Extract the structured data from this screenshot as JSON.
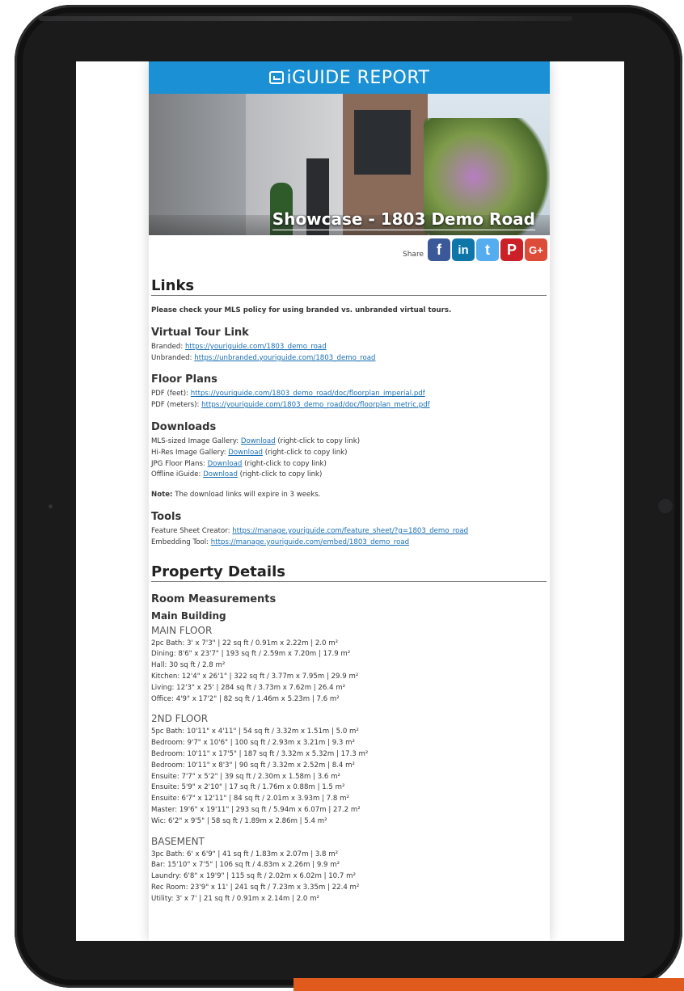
{
  "header": {
    "brand": "iGUIDE REPORT"
  },
  "hero": {
    "caption": "Showcase - 1803 Demo Road"
  },
  "share": {
    "label": "Share",
    "icons": [
      {
        "name": "facebook",
        "glyph": "f",
        "color": "#3b5998"
      },
      {
        "name": "linkedin",
        "glyph": "in",
        "color": "#0e76a8"
      },
      {
        "name": "twitter",
        "glyph": "t",
        "color": "#55acee"
      },
      {
        "name": "pinterest",
        "glyph": "P",
        "color": "#cb2027"
      },
      {
        "name": "google-plus",
        "glyph": "G+",
        "color": "#dd4b39"
      }
    ]
  },
  "links": {
    "title": "Links",
    "intro": "Please check your MLS policy for using branded vs. unbranded virtual tours.",
    "virtual_tour": {
      "title": "Virtual Tour Link",
      "branded_label": "Branded:",
      "branded_url": "https://youriguide.com/1803_demo_road",
      "unbranded_label": "Unbranded:",
      "unbranded_url": "https://unbranded.youriguide.com/1803_demo_road"
    },
    "floor_plans": {
      "title": "Floor Plans",
      "feet_label": "PDF (feet):",
      "feet_url": "https://youriguide.com/1803_demo_road/doc/floorplan_imperial.pdf",
      "meters_label": "PDF (meters):",
      "meters_url": "https://youriguide.com/1803_demo_road/doc/floorplan_metric.pdf"
    },
    "downloads": {
      "title": "Downloads",
      "items": [
        {
          "label": "MLS-sized Image Gallery:",
          "link": "Download",
          "hint": "(right-click to copy link)"
        },
        {
          "label": "Hi-Res Image Gallery:",
          "link": "Download",
          "hint": "(right-click to copy link)"
        },
        {
          "label": "JPG Floor Plans:",
          "link": "Download",
          "hint": "(right-click to copy link)"
        },
        {
          "label": "Offline iGuide:",
          "link": "Download",
          "hint": "(right-click to copy link)"
        }
      ],
      "note_label": "Note:",
      "note_text": "The download links will expire in 3 weeks."
    },
    "tools": {
      "title": "Tools",
      "feature_label": "Feature Sheet Creator:",
      "feature_url": "https://manage.youriguide.com/feature_sheet/?g=1803_demo_road",
      "embed_label": "Embedding Tool:",
      "embed_url": "https://manage.youriguide.com/embed/1803_demo_road"
    }
  },
  "property": {
    "title": "Property Details",
    "room_title": "Room Measurements",
    "building": "Main Building",
    "floors": [
      {
        "name": "MAIN FLOOR",
        "rooms": [
          "2pc Bath: 3' x 7'3\" | 22 sq ft  /  0.91m x 2.22m | 2.0 m²",
          "Dining: 8'6\" x 23'7\" | 193 sq ft  /  2.59m x 7.20m | 17.9 m²",
          "Hall: 30 sq ft  /  2.8 m²",
          "Kitchen: 12'4\" x 26'1\" | 322 sq ft  /  3.77m x 7.95m | 29.9 m²",
          "Living: 12'3\" x 25' | 284 sq ft  /  3.73m x 7.62m | 26.4 m²",
          "Office: 4'9\" x 17'2\" | 82 sq ft  /  1.46m x 5.23m | 7.6 m²"
        ]
      },
      {
        "name": "2ND FLOOR",
        "rooms": [
          "5pc Bath: 10'11\" x 4'11\" | 54 sq ft  /  3.32m x 1.51m | 5.0 m²",
          "Bedroom: 9'7\" x 10'6\" | 100 sq ft  /  2.93m x 3.21m | 9.3 m²",
          "Bedroom: 10'11\" x 17'5\" | 187 sq ft  /  3.32m x 5.32m | 17.3 m²",
          "Bedroom: 10'11\" x 8'3\" | 90 sq ft  /  3.32m x 2.52m | 8.4 m²",
          "Ensuite: 7'7\" x 5'2\" | 39 sq ft  /  2.30m x 1.58m | 3.6 m²",
          "Ensuite: 5'9\" x 2'10\" | 17 sq ft  /  1.76m x 0.88m | 1.5 m²",
          "Ensuite: 6'7\" x 12'11\" | 84 sq ft  /  2.01m x 3.93m | 7.8 m²",
          "Master: 19'6\" x 19'11\" | 293 sq ft  /  5.94m x 6.07m | 27.2 m²",
          "Wic: 6'2\" x 9'5\" | 58 sq ft  /  1.89m x 2.86m | 5.4 m²"
        ]
      },
      {
        "name": "BASEMENT",
        "rooms": [
          "3pc Bath: 6' x 6'9\" | 41 sq ft  /  1.83m x 2.07m | 3.8 m²",
          "Bar: 15'10\" x 7'5\" | 106 sq ft  /  4.83m x 2.26m | 9.9 m²",
          "Laundry: 6'8\" x 19'9\" | 115 sq ft  /  2.02m x 6.02m | 10.7 m²",
          "Rec Room: 23'9\" x 11' | 241 sq ft  /  7.23m x 3.35m | 22.4 m²",
          "Utility: 3' x 7' | 21 sq ft  /  0.91m x 2.14m | 2.0 m²"
        ]
      }
    ]
  }
}
